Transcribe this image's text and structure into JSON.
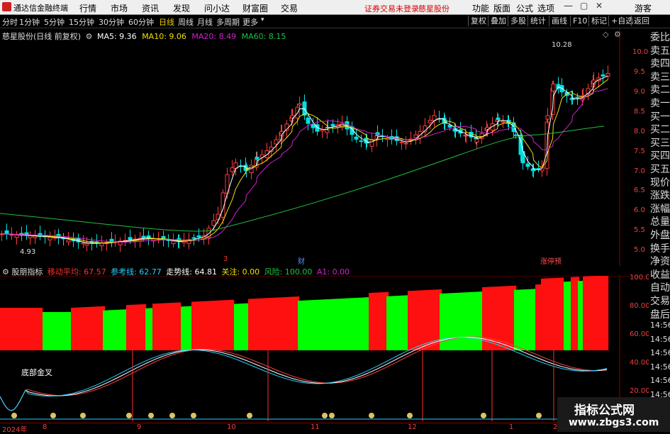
{
  "app": {
    "title": "通达信金融终端",
    "warning": "证券交易未登录",
    "stock_link": "慈星股份"
  },
  "menu": {
    "items": [
      "行情",
      "市场",
      "资讯",
      "发现",
      "问小达",
      "财富圈",
      "交易"
    ],
    "right": [
      "功能",
      "版面",
      "公式",
      "选项"
    ],
    "guest": "游客"
  },
  "periods": {
    "items": [
      "分时",
      "1分钟",
      "5分钟",
      "15分钟",
      "30分钟",
      "60分钟",
      "日线",
      "周线",
      "月线",
      "多周期",
      "更多"
    ],
    "active": "日线"
  },
  "tools": [
    "复权",
    "叠加",
    "多股",
    "统计",
    "画线",
    "F10",
    "标记",
    "+自选",
    "返回"
  ],
  "chart_header": {
    "name": "慈星股份(日线 前复权)",
    "ma5": "MA5: 9.36",
    "ma10": "MA10: 9.06",
    "ma20": "MA20: 8.49",
    "ma60": "MA60: 8.15"
  },
  "price_axis": [
    "10.00",
    "9.5",
    "9.0",
    "8.5",
    "8.0",
    "7.5",
    "7.0",
    "6.5",
    "6.0",
    "5.5",
    "5.0"
  ],
  "labels": {
    "high": "10.28",
    "low": "4.93",
    "fin": "财",
    "event1": "3",
    "event2": "涨停预"
  },
  "indicator": {
    "name": "股朋指标",
    "ma": "移动平均: 67.57",
    "ref": "参考线: 62.77",
    "trend": "走势线: 64.81",
    "focus": "关注: 0.00",
    "risk": "风险: 100.00",
    "a1": "A1: 0.00",
    "annotation": "底部金叉"
  },
  "indicator_axis": [
    "100.0",
    "80.00",
    "60.00",
    "40.00",
    "20.00"
  ],
  "date_axis": [
    "2024年",
    "8",
    "9",
    "10",
    "11",
    "12",
    "1",
    "2"
  ],
  "right_panel": [
    "委比",
    "卖五",
    "卖四",
    "卖三",
    "卖二",
    "卖一",
    "买一",
    "买二",
    "买三",
    "买四",
    "买五",
    "现价",
    "涨跌",
    "涨幅",
    "总量",
    "外盘",
    "换手",
    "净资",
    "收益",
    "自动",
    "交易",
    "盘后"
  ],
  "right_times": [
    "14:56",
    "14:56",
    "14:56",
    "14:56",
    "14:56",
    "14:56",
    "14:56"
  ],
  "watermark": {
    "line1": "指标公式网",
    "line2": "www.zbgs3.com"
  },
  "colors": {
    "up": "#ff3c3c",
    "down": "#00e0e0",
    "ma5": "#ffffff",
    "ma10": "#f0e000",
    "ma20": "#d020d0",
    "ma60": "#20c040",
    "bar_red": "#ff1010",
    "bar_green": "#00ff00"
  }
}
